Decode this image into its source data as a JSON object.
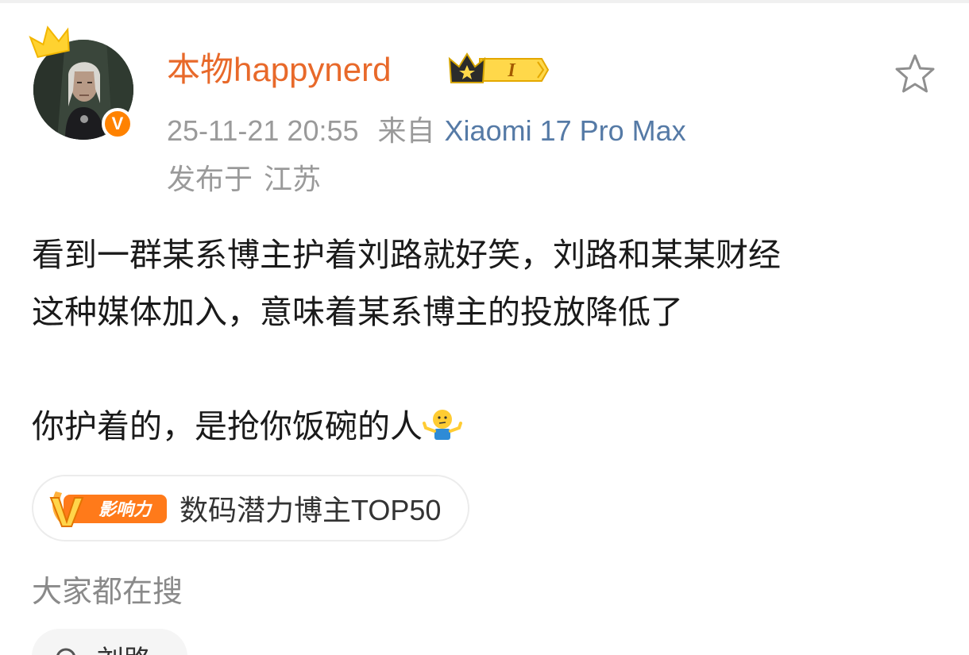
{
  "post": {
    "author": {
      "name": "本物happynerd",
      "member_level": "I",
      "verified_mark": "V",
      "avatar": "profile-photo"
    },
    "meta": {
      "timestamp": "25-11-21 20:55",
      "source_label": "来自",
      "device": "Xiaomi 17 Pro Max",
      "location_label": "发布于",
      "location": "江苏"
    },
    "content": {
      "line1": "看到一群某系博主护着刘路就好笑，刘路和某某财经",
      "line2": "这种媒体加入，意味着某系博主的投放降低了",
      "line3": "你护着的，是抢你饭碗的人",
      "emoji": "shrug-emoji"
    },
    "tag": {
      "badge_letter": "V",
      "badge_text": "影响力",
      "label": "数码潜力博主TOP50"
    },
    "favorite_icon": "star-outline-icon"
  },
  "search": {
    "heading": "大家都在搜",
    "chips": [
      {
        "text": "刘路",
        "icon": "search-icon"
      }
    ]
  },
  "colors": {
    "username": "#e8692a",
    "device_link": "#557aa6",
    "meta_gray": "#9a9a9a",
    "verify_orange": "#ff8200"
  }
}
